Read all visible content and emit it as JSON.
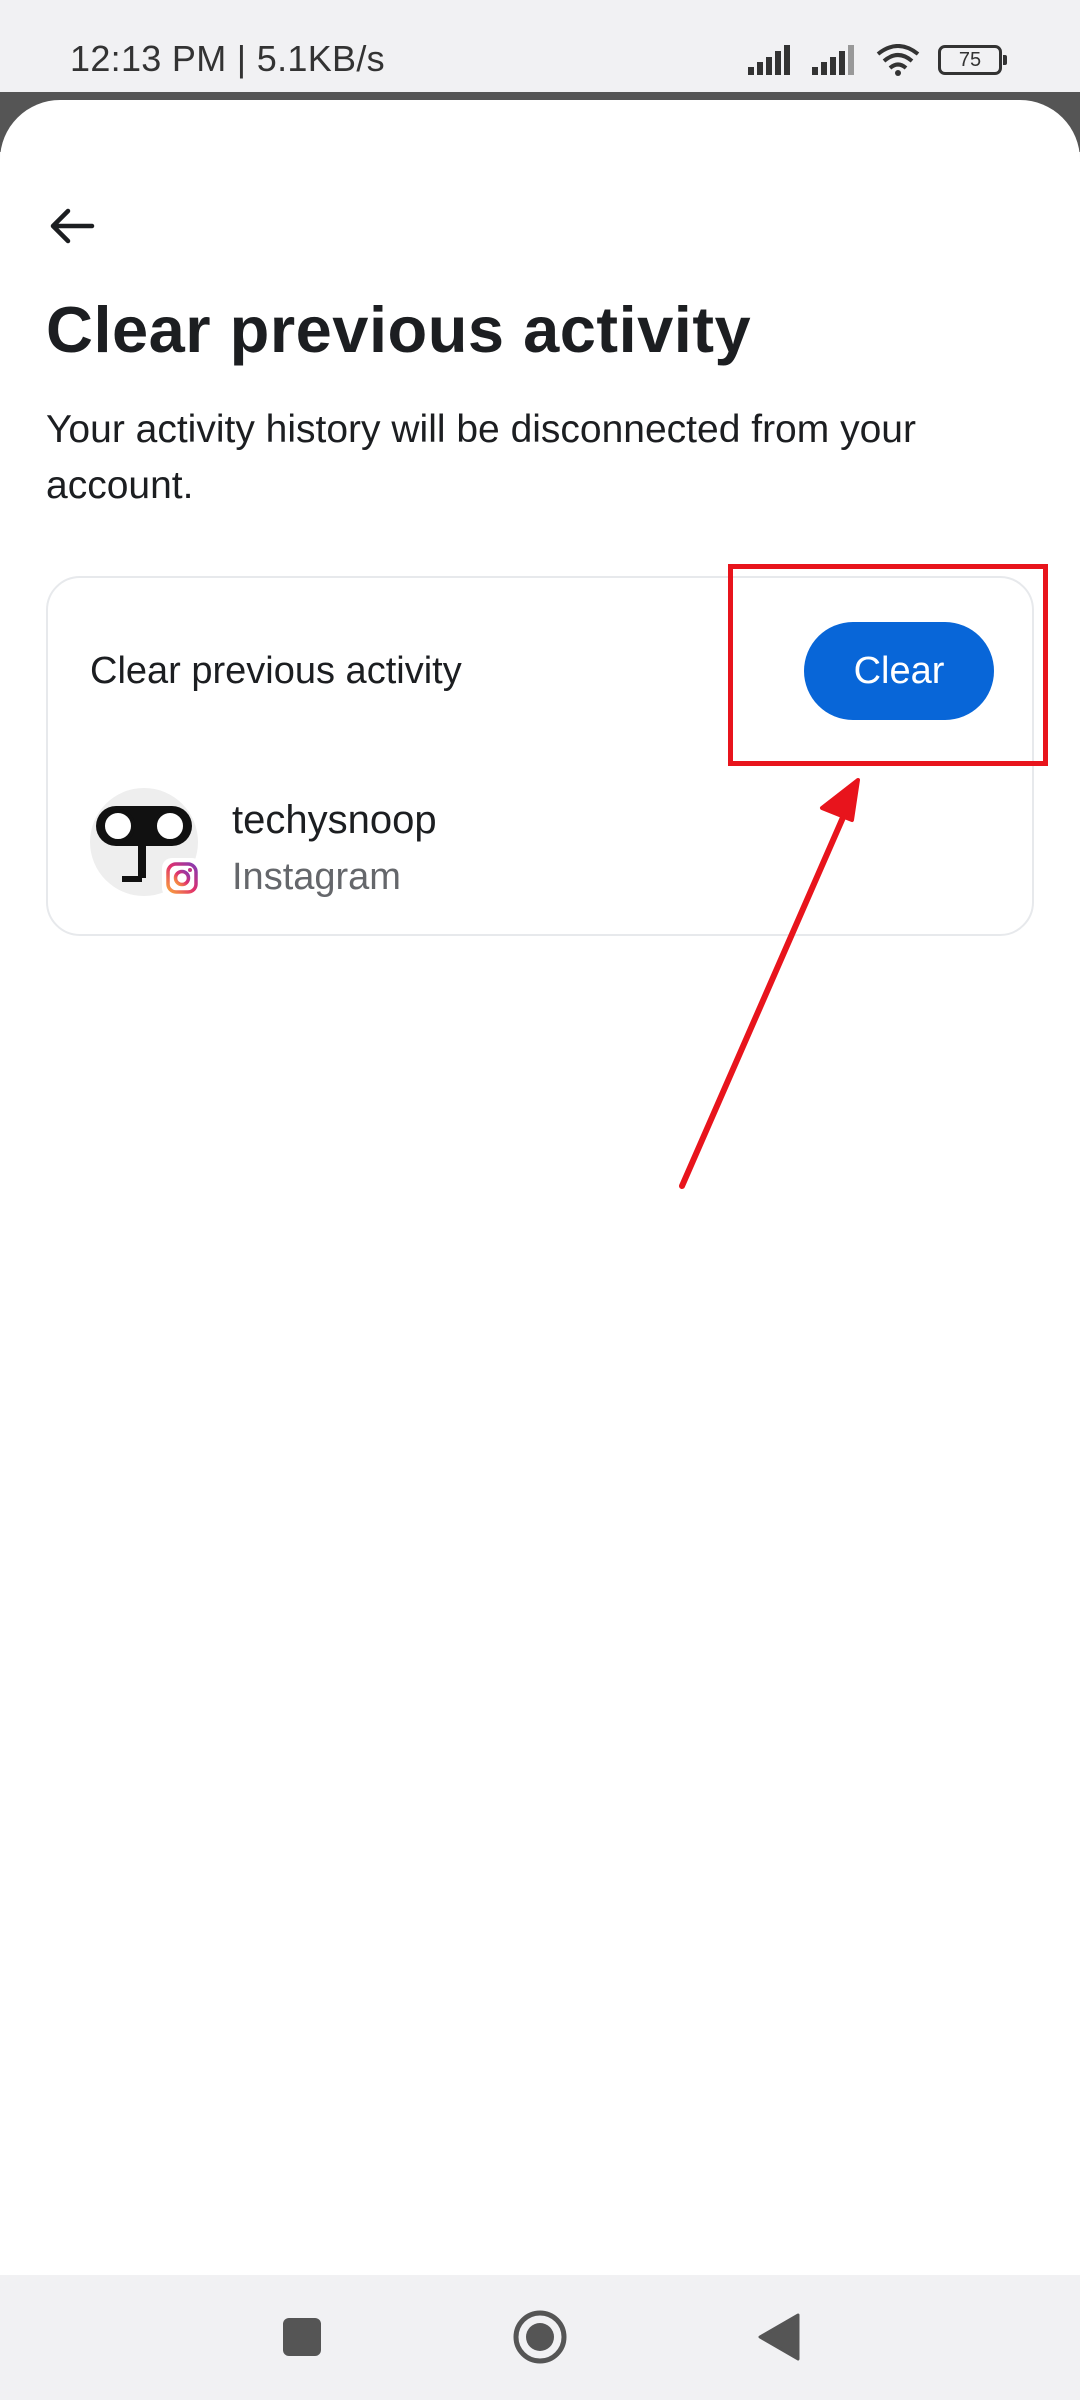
{
  "status_bar": {
    "time": "12:13 PM | 5.1KB/s",
    "battery": "75"
  },
  "page": {
    "title": "Clear previous activity",
    "subtitle": "Your activity history will be disconnected from your account."
  },
  "card": {
    "title": "Clear previous activity",
    "clear_label": "Clear",
    "account": {
      "username": "techysnoop",
      "app": "Instagram"
    }
  },
  "colors": {
    "primary_button": "#0866d8",
    "annotation": "#e8141c"
  },
  "icons": {
    "back": "back-arrow-icon",
    "badge": "instagram-icon",
    "nav_recents": "square-icon",
    "nav_home": "circle-icon",
    "nav_back": "triangle-back-icon"
  }
}
